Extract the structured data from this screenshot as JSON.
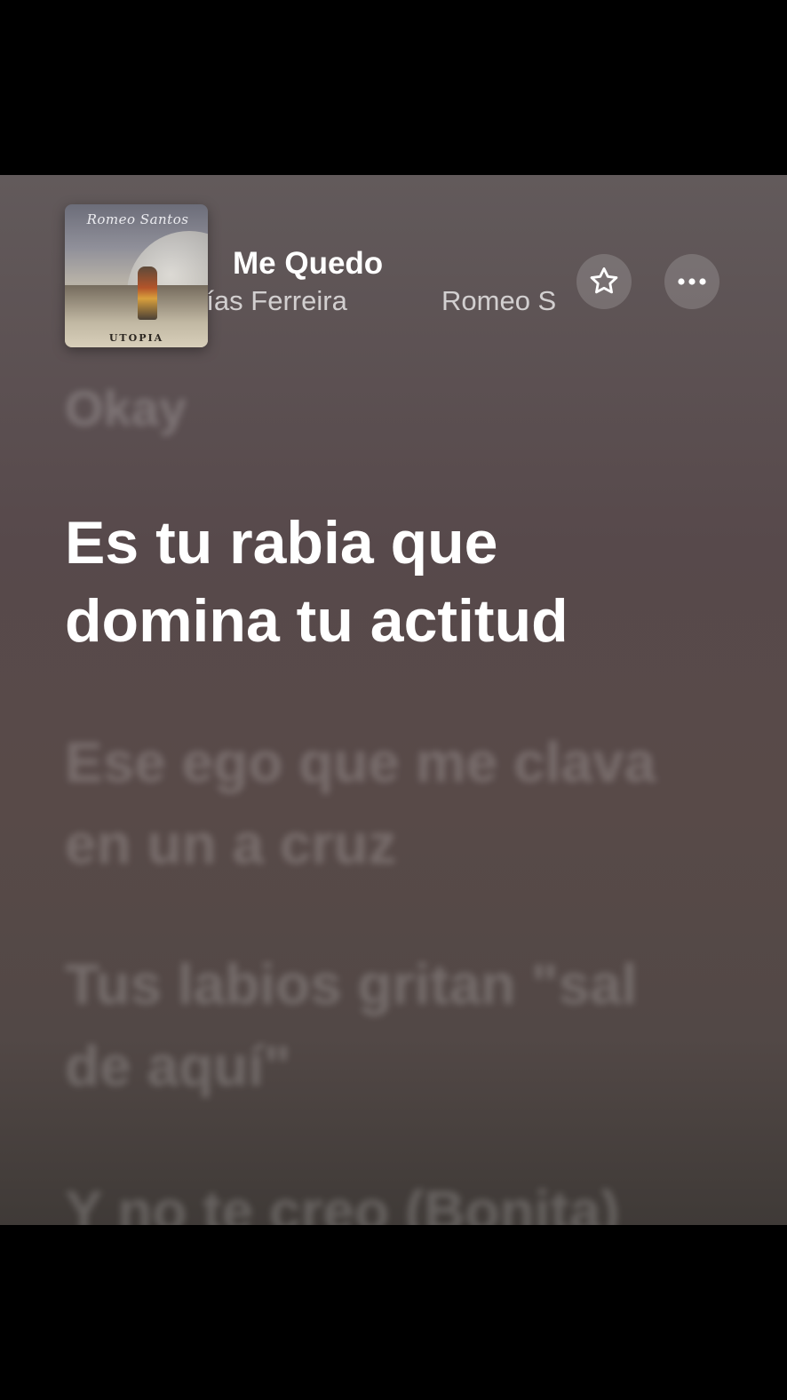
{
  "now_playing": {
    "title": "Me Quedo",
    "artists": [
      "rías Ferreira",
      "Romeo S"
    ],
    "album": {
      "script_text": "Romeo Santos",
      "name": "UTOPIA"
    }
  },
  "controls": {
    "favorite_icon": "star-outline-icon",
    "more_icon": "ellipsis-icon"
  },
  "lyrics": {
    "previous": "Okay",
    "current": "Es tu rabia que domina tu actitud",
    "upcoming": [
      "Ese ego que me clava en un a cruz",
      "Tus labios gritan \"sal de aquí\"",
      "Y no te creo (Bonita)"
    ]
  },
  "colors": {
    "background_top": "#625a5b",
    "background_bottom": "#3f3a37",
    "active_lyric": "#ffffff"
  }
}
